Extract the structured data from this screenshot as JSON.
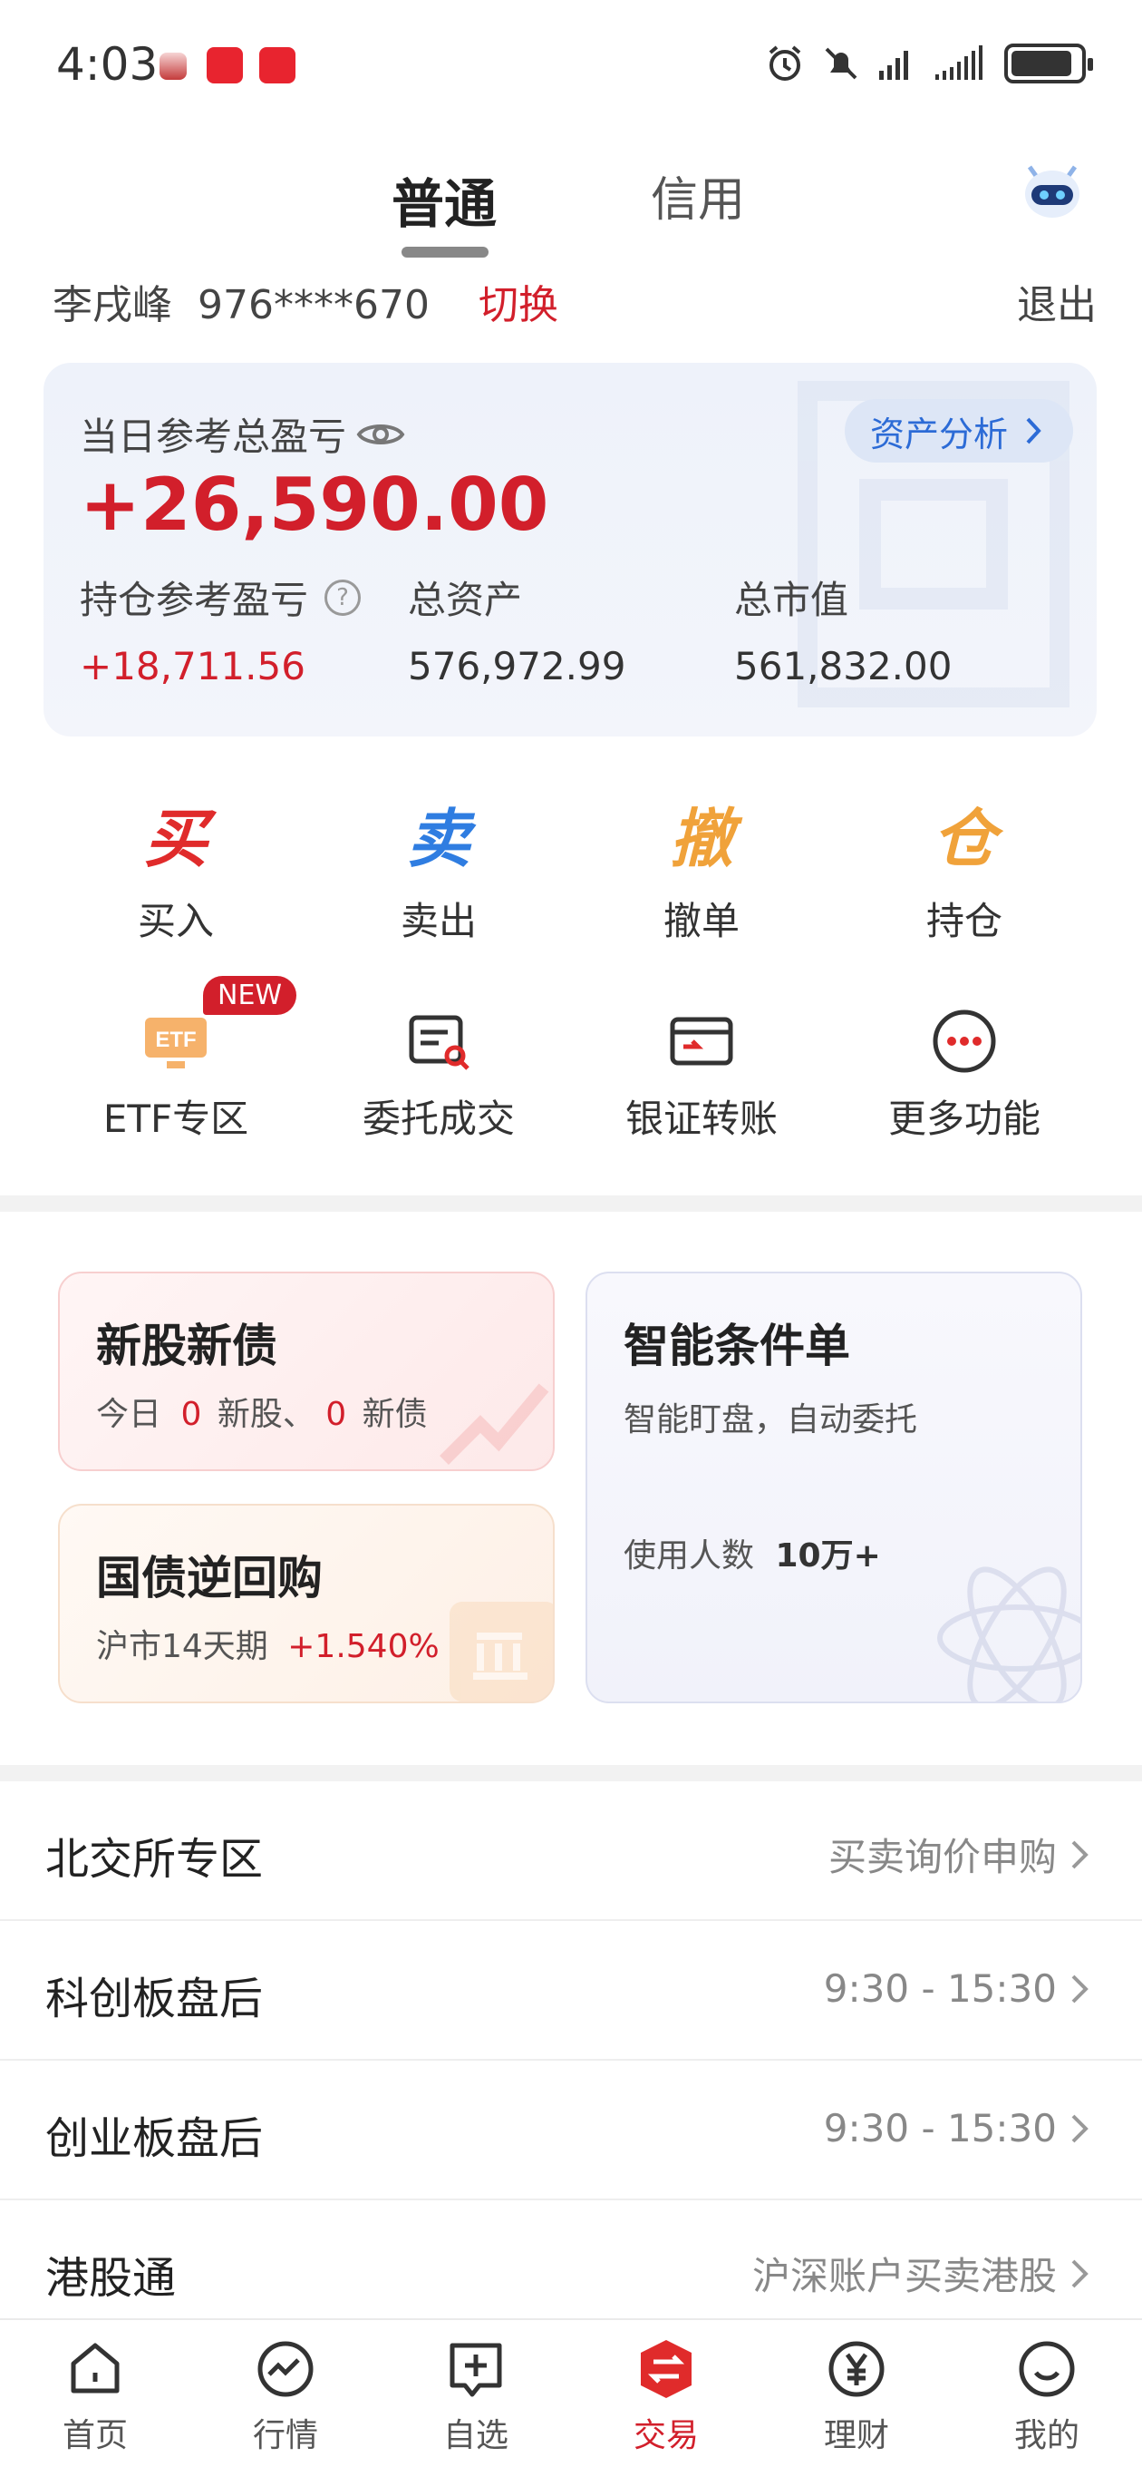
{
  "status_bar": {
    "time": "4:03"
  },
  "tabs": {
    "normal": "普通",
    "credit": "信用"
  },
  "account": {
    "name": "李戌峰",
    "number": "976****670",
    "switch_label": "切换",
    "logout_label": "退出"
  },
  "asset_card": {
    "daily_pl_label": "当日参考总盈亏",
    "daily_pl_value": "+26,590.00",
    "analysis_button": "资产分析",
    "position_pl_label": "持仓参考盈亏",
    "position_pl_value": "+18,711.56",
    "total_assets_label": "总资产",
    "total_assets_value": "576,972.99",
    "market_value_label": "总市值",
    "market_value_value": "561,832.00"
  },
  "actions": [
    {
      "glyph": "买",
      "label": "买入",
      "color": "#e02b2b"
    },
    {
      "glyph": "卖",
      "label": "卖出",
      "color": "#2f7de1"
    },
    {
      "glyph": "撤",
      "label": "撤单",
      "color": "#f0a23a"
    },
    {
      "glyph": "仓",
      "label": "持仓",
      "color": "#f0a23a"
    }
  ],
  "tools": [
    {
      "label": "ETF专区",
      "badge": "NEW",
      "icon_text": "ETF"
    },
    {
      "label": "委托成交"
    },
    {
      "label": "银证转账"
    },
    {
      "label": "更多功能"
    }
  ],
  "cards": {
    "ipo": {
      "title": "新股新债",
      "sub_prefix": "今日",
      "stock_count": "0",
      "stock_label": "新股、",
      "bond_count": "0",
      "bond_label": "新债"
    },
    "repo": {
      "title": "国债逆回购",
      "sub_prefix": "沪市14天期",
      "rate": "+1.540%"
    },
    "smart": {
      "title": "智能条件单",
      "sub": "智能盯盘，自动委托",
      "users_label": "使用人数",
      "users_value": "10万+"
    }
  },
  "list": [
    {
      "label": "北交所专区",
      "right": "买卖询价申购"
    },
    {
      "label": "科创板盘后",
      "right": "9:30 - 15:30"
    },
    {
      "label": "创业板盘后",
      "right": "9:30 - 15:30"
    },
    {
      "label": "港股通",
      "right": "沪深账户买卖港股"
    }
  ],
  "bottom_nav": [
    {
      "label": "首页"
    },
    {
      "label": "行情"
    },
    {
      "label": "自选"
    },
    {
      "label": "交易"
    },
    {
      "label": "理财"
    },
    {
      "label": "我的"
    }
  ]
}
